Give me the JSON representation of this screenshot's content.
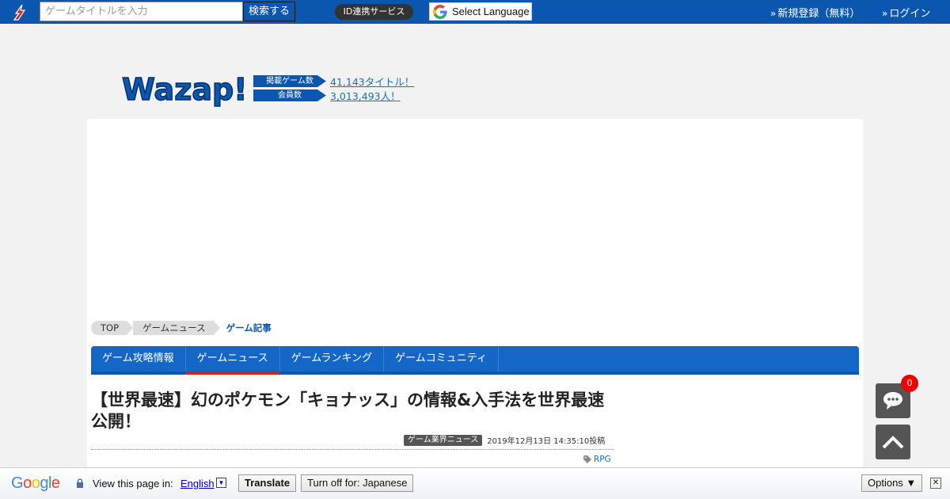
{
  "topbar": {
    "search_placeholder": "ゲームタイトルを入力",
    "search_button": "検索する",
    "id_service": "ID連携サービス",
    "language_select": "Select Language",
    "register": "新規登録（無料）",
    "login": "ログイン"
  },
  "header": {
    "logo_text": "Wazap!",
    "stats": [
      {
        "label": "掲載ゲーム数",
        "value": "41,143タイトル！"
      },
      {
        "label": "会員数",
        "value": "3,013,493人！"
      }
    ]
  },
  "breadcrumb": [
    "TOP",
    "ゲームニュース",
    "ゲーム記事"
  ],
  "nav": {
    "tabs": [
      "ゲーム攻略情報",
      "ゲームニュース",
      "ゲームランキング",
      "ゲームコミュニティ"
    ],
    "active_index": 1
  },
  "article": {
    "title": "【世界最速】幻のポケモン「キョナッス」の情報&入手法を世界最速公開！",
    "category": "ゲーム業界ニュース",
    "date": "2019年12月13日 14:35:10投稿",
    "tag": "RPG"
  },
  "floating": {
    "comment_count": "0"
  },
  "translate_bar": {
    "view_text": "View this page in:",
    "language": "English",
    "translate_button": "Translate",
    "turn_off_button": "Turn off for: Japanese",
    "options_button": "Options ▼"
  },
  "colors": {
    "brand_blue": "#0b57b0",
    "nav_blue": "#1467c6",
    "active_red": "#d81e1e",
    "link_blue": "#1870c2"
  }
}
